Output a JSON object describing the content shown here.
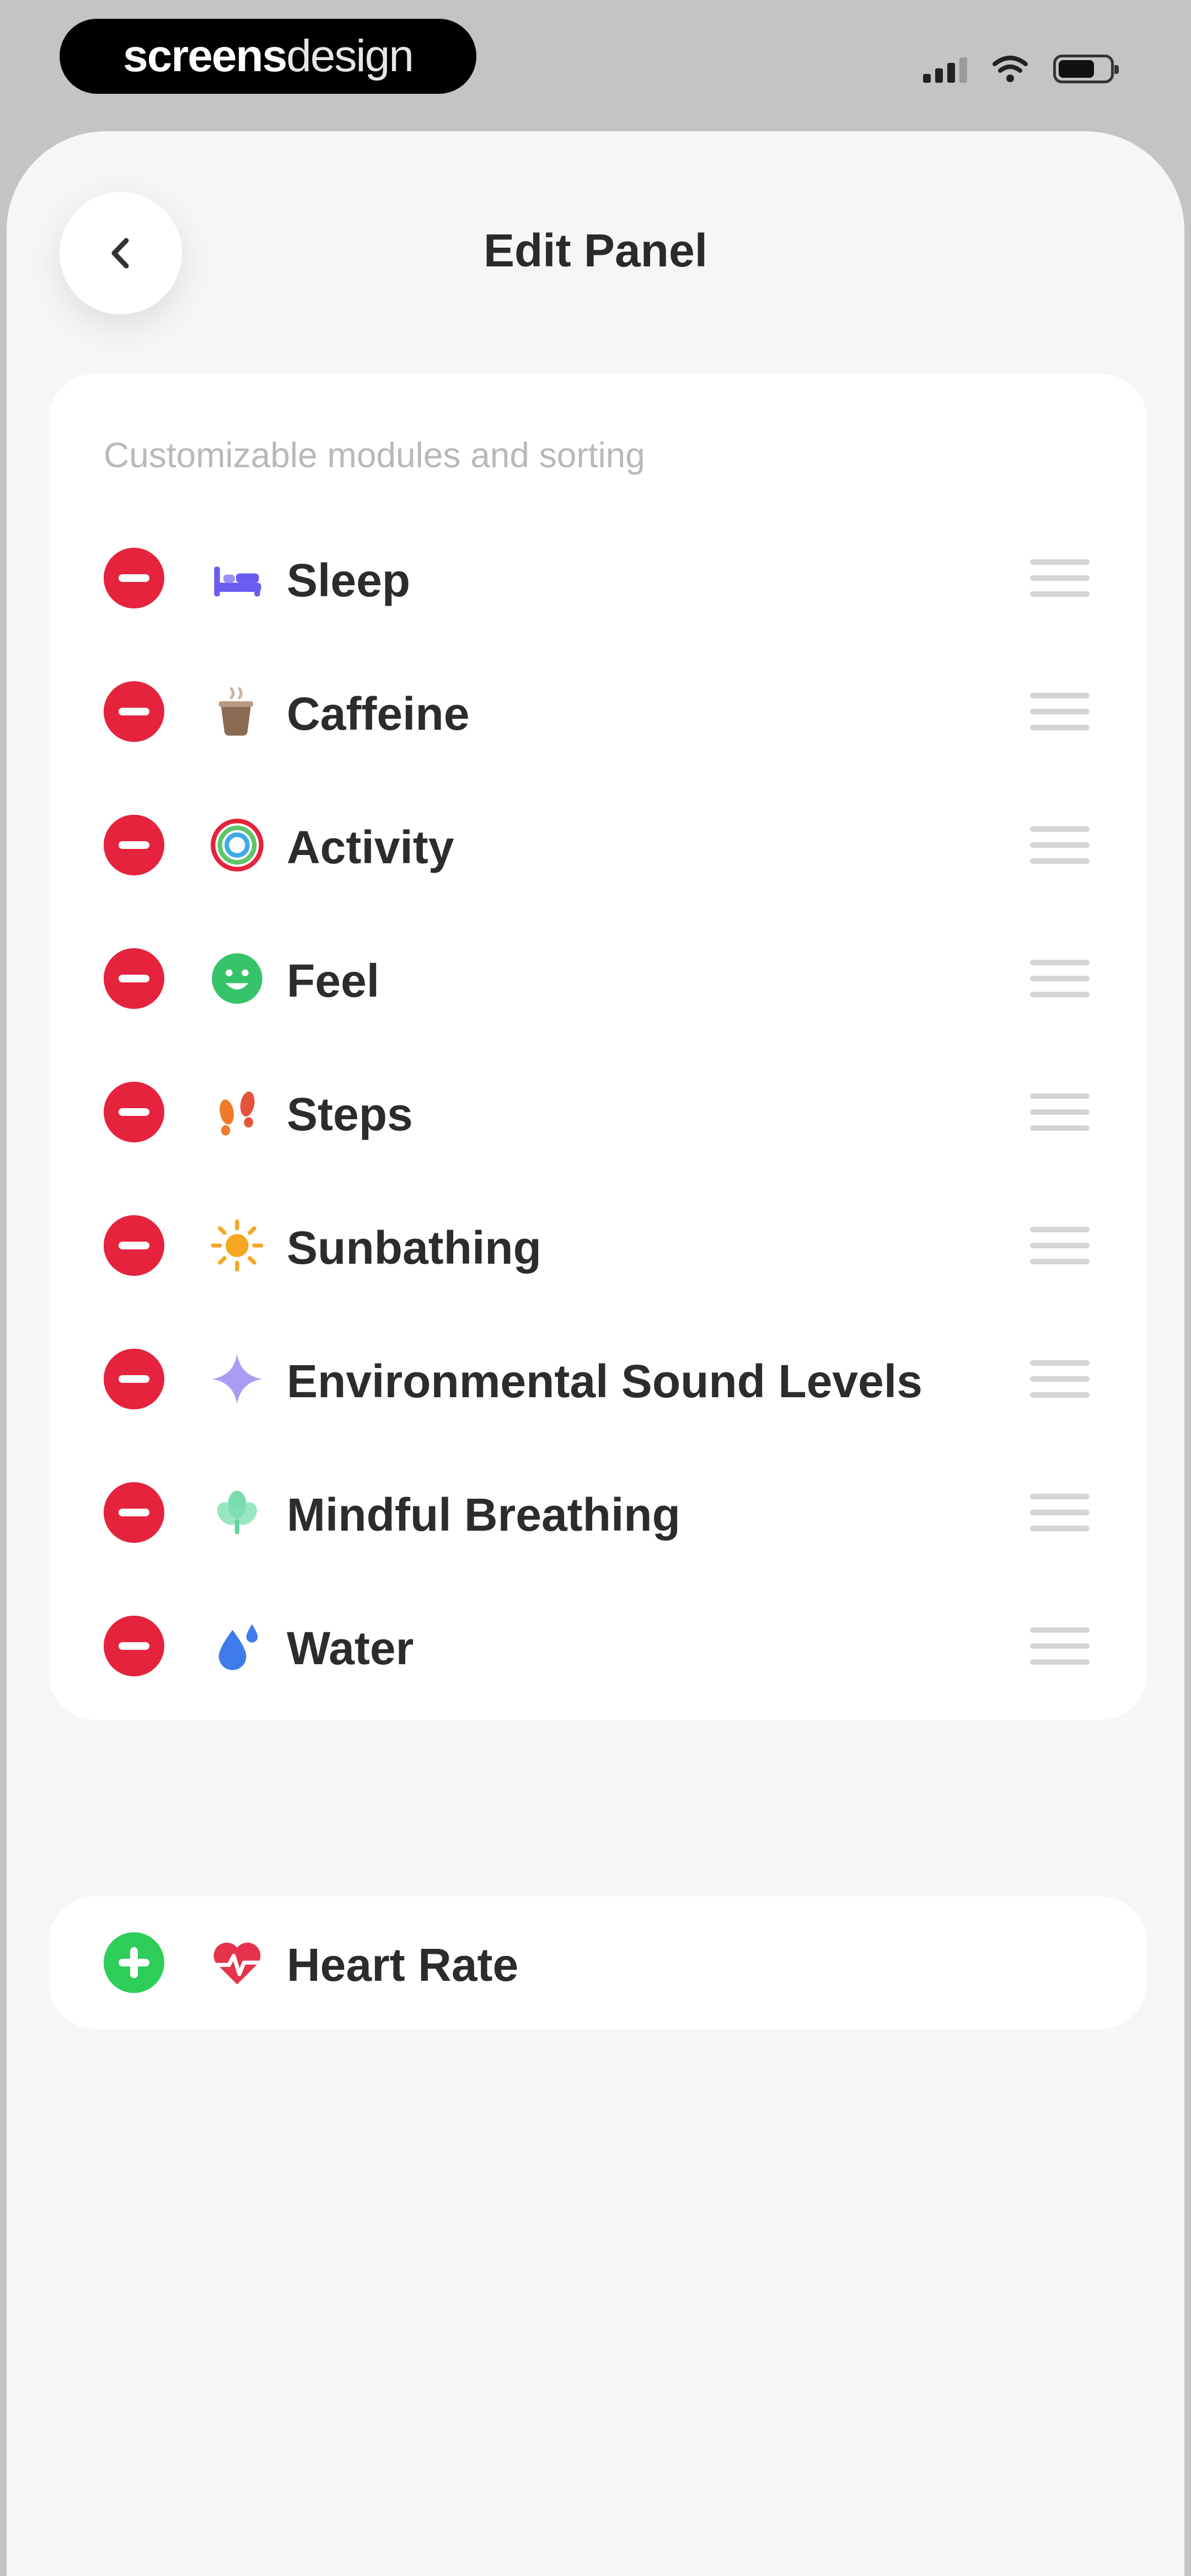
{
  "status_bar": {
    "brand_bold": "screens",
    "brand_light": "design"
  },
  "header": {
    "title": "Edit Panel",
    "back_icon": "chevron-left-icon"
  },
  "main_section": {
    "caption": "Customizable modules and sorting",
    "remove_icon": "minus-circle-icon",
    "drag_icon": "drag-handle-icon",
    "items": [
      {
        "label": "Sleep",
        "icon": "bed-icon",
        "color": "#6b5cf0"
      },
      {
        "label": "Caffeine",
        "icon": "coffee-cup-icon",
        "color": "#8a6a52"
      },
      {
        "label": "Activity",
        "icon": "activity-ring-icon",
        "color": "#e5233d"
      },
      {
        "label": "Feel",
        "icon": "smiley-icon",
        "color": "#35c46a"
      },
      {
        "label": "Steps",
        "icon": "footprints-icon",
        "color": "#f07a2a"
      },
      {
        "label": "Sunbathing",
        "icon": "sun-icon",
        "color": "#f5a623"
      },
      {
        "label": "Environmental Sound Levels",
        "icon": "sound-sparkle-icon",
        "color": "#a99cf5"
      },
      {
        "label": "Mindful Breathing",
        "icon": "breathing-flower-icon",
        "color": "#5fd6a0"
      },
      {
        "label": "Water",
        "icon": "water-drop-icon",
        "color": "#3f7bea"
      }
    ]
  },
  "extra_section": {
    "add_icon": "plus-circle-icon",
    "items": [
      {
        "label": "Heart Rate",
        "icon": "heart-rate-icon",
        "color": "#e5334d"
      }
    ]
  },
  "colors": {
    "remove": "#e5233d",
    "add": "#2ecc59",
    "background": "#f6f6f6",
    "card": "#ffffff"
  }
}
